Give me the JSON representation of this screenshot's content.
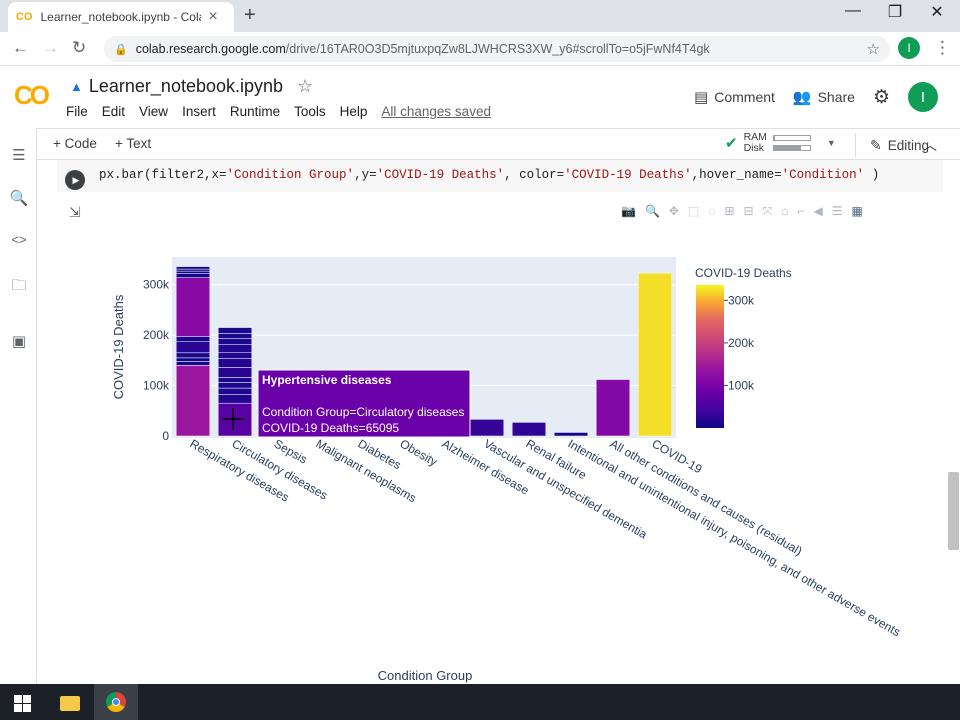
{
  "browser": {
    "tab_title": "Learner_notebook.ipynb - Colab",
    "url_host": "colab.research.google.com",
    "url_path": "/drive/16TAR0O3D5mjtuxpqZw8LJWHCRS3XW_y6#scrollTo=o5jFwNf4T4gk",
    "profile_initial": "I"
  },
  "colab": {
    "logo": "CO",
    "notebook_title": "Learner_notebook.ipynb",
    "menu": [
      "File",
      "Edit",
      "View",
      "Insert",
      "Runtime",
      "Tools",
      "Help"
    ],
    "save_status": "All changes saved",
    "comment_label": "Comment",
    "share_label": "Share",
    "user_initial": "I",
    "toolbar": {
      "add_code": "+ Code",
      "add_text": "+ Text",
      "ram_label": "RAM",
      "disk_label": "Disk",
      "ram_level": 0.04,
      "disk_level": 0.75,
      "editing_label": "Editing"
    }
  },
  "cell": {
    "code_parts": [
      "px.bar(filter2,x=",
      "'Condition Group'",
      ",y=",
      "'COVID-19 Deaths'",
      ", color=",
      "'COVID-19 Deaths'",
      ",hover_name=",
      "'Condition'",
      " )"
    ]
  },
  "chart_data": {
    "type": "bar",
    "xlabel": "Condition Group",
    "ylabel": "COVID-19 Deaths",
    "ylim": [
      0,
      355000
    ],
    "y_ticks": [
      0,
      100000,
      200000,
      300000
    ],
    "y_tick_labels": [
      "0",
      "100k",
      "200k",
      "300k"
    ],
    "categories": [
      "Respiratory diseases",
      "Circulatory diseases",
      "Sepsis",
      "Malignant neoplasms",
      "Diabetes",
      "Obesity",
      "Alzheimer disease",
      "Vascular and unspecified dementia",
      "Renal failure",
      "Intentional and unintentional injury, poisoning, and other adverse events",
      "All other conditions and causes (residual)",
      "COVID-19"
    ],
    "values": [
      336000,
      215000,
      9000,
      8500,
      30000,
      7500,
      12000,
      33000,
      27000,
      7000,
      112000,
      323000
    ],
    "stacks": {
      "Respiratory diseases": [
        140000,
        8000,
        7000,
        10000,
        22000,
        10000,
        117000,
        8000,
        5000,
        4000,
        5000
      ],
      "Circulatory diseases": [
        65095,
        17000,
        13000,
        11000,
        10000,
        20000,
        18000,
        12000,
        15000,
        12000,
        10000,
        12000
      ]
    },
    "colorbar": {
      "title": "COVID-19 Deaths",
      "range": [
        0,
        336000
      ],
      "ticks": [
        100000,
        200000,
        300000
      ],
      "tick_labels": [
        "100k",
        "200k",
        "300k"
      ]
    },
    "hover": {
      "name": "Hypertensive diseases",
      "line1": "Condition Group=Circulatory diseases",
      "line2": "COVID-19 Deaths=65095"
    },
    "grid": true,
    "legend": "colorbar-right"
  }
}
